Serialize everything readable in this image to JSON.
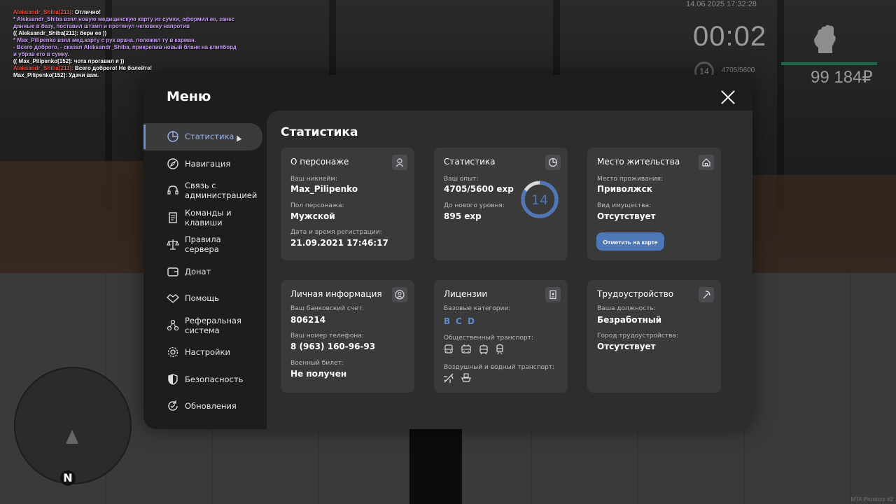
{
  "chat": [
    {
      "segments": [
        {
          "t": "Aleksandr_Shiba[211]:",
          "c": "red"
        },
        {
          "t": " Отлично!",
          "c": "white"
        }
      ]
    },
    {
      "segments": [
        {
          "t": " * Aleksandr_Shiba взял новую медицинскую карту из сумки, оформил ее, занес",
          "c": "purple"
        }
      ]
    },
    {
      "segments": [
        {
          "t": "   данные в базу, поставил штамп и протянул человеку напротив",
          "c": "purple"
        }
      ]
    },
    {
      "segments": [
        {
          "t": "(( Aleksandr_Shiba[211]: бери ее ))",
          "c": "white"
        }
      ]
    },
    {
      "segments": [
        {
          "t": " * Max_Pilipenko взял мед.карту с рук врача, положил ту в карман.",
          "c": "purple"
        }
      ]
    },
    {
      "segments": [
        {
          "t": " - Всего доброго, - сказал Aleksandr_Shiba, прикрепив новый бланк на клипборд",
          "c": "purple"
        }
      ]
    },
    {
      "segments": [
        {
          "t": "  и убрав его в сумку.",
          "c": "purple"
        }
      ]
    },
    {
      "segments": [
        {
          "t": "(( Max_Pilipenko[152]: чота прогавил я ))",
          "c": "white"
        }
      ]
    },
    {
      "segments": [
        {
          "t": "Aleksandr_Shiba[211]:",
          "c": "red"
        },
        {
          "t": " Всего доброго! Не болейте!",
          "c": "white"
        }
      ]
    },
    {
      "segments": [
        {
          "t": "Max_Pilipenko[152]: Удачи вам.",
          "c": "white"
        }
      ]
    }
  ],
  "hud": {
    "datetime": "14.06.2025 17:32:28",
    "timer": "00:02",
    "level": "14",
    "exp": "4705/5600",
    "money": "99 184₽",
    "minimap_north": "N",
    "brand": "MTA Province #2"
  },
  "menu": {
    "title": "Меню",
    "sidebar": [
      {
        "label": "Статистика",
        "icon": "pie-chart-icon",
        "active": true
      },
      {
        "label": "Навигация",
        "icon": "compass-icon"
      },
      {
        "label": "Связь с администрацией",
        "icon": "headset-icon"
      },
      {
        "label": "Команды и клавиши",
        "icon": "document-icon"
      },
      {
        "label": "Правила сервера",
        "icon": "scales-icon"
      },
      {
        "label": "Донат",
        "icon": "wallet-icon"
      },
      {
        "label": "Помощь",
        "icon": "handshake-icon"
      },
      {
        "label": "Реферальная система",
        "icon": "referral-icon"
      },
      {
        "label": "Настройки",
        "icon": "gear-icon"
      },
      {
        "label": "Безопасность",
        "icon": "shield-icon"
      },
      {
        "label": "Обновления",
        "icon": "refresh-icon"
      }
    ]
  },
  "content": {
    "title": "Статистика",
    "character": {
      "title": "О персонаже",
      "nick_label": "Ваш никнейм:",
      "nick": "Max_Pilipenko",
      "gender_label": "Пол персонажа:",
      "gender": "Мужской",
      "reg_label": "Дата и время регистрации:",
      "reg": "21.09.2021 17:46:17"
    },
    "stats": {
      "title": "Статистика",
      "exp_label": "Ваш опыт:",
      "exp": "4705/5600 exp",
      "next_label": "До нового уровня:",
      "next": "895 exp",
      "level": "14",
      "progress": 0.84
    },
    "residence": {
      "title": "Место жительства",
      "place_label": "Место проживания:",
      "place": "Приволжск",
      "property_label": "Вид имущества:",
      "property": "Отсутствует",
      "map_button": "Отметить на карте"
    },
    "personal": {
      "title": "Личная информация",
      "bank_label": "Ваш банковский счет:",
      "bank": "806214",
      "phone_label": "Ваш номер телефона:",
      "phone": "8 (963) 160-96-93",
      "military_label": "Военный билет:",
      "military": "Не получен"
    },
    "licenses": {
      "title": "Лицензии",
      "base_label": "Базовые категории:",
      "categories": [
        "B",
        "C",
        "D"
      ],
      "public_label": "Общественный транспорт:",
      "public_icons": [
        "bus-icon",
        "trolleybus-icon",
        "tram-icon",
        "train-icon"
      ],
      "air_label": "Воздушный и водный транспорт:",
      "air_icons": [
        "plane-icon",
        "boat-icon"
      ]
    },
    "job": {
      "title": "Трудоустройство",
      "position_label": "Ваша должность:",
      "position": "Безработный",
      "city_label": "Город трудоустройства:",
      "city": "Отсутствует"
    }
  }
}
